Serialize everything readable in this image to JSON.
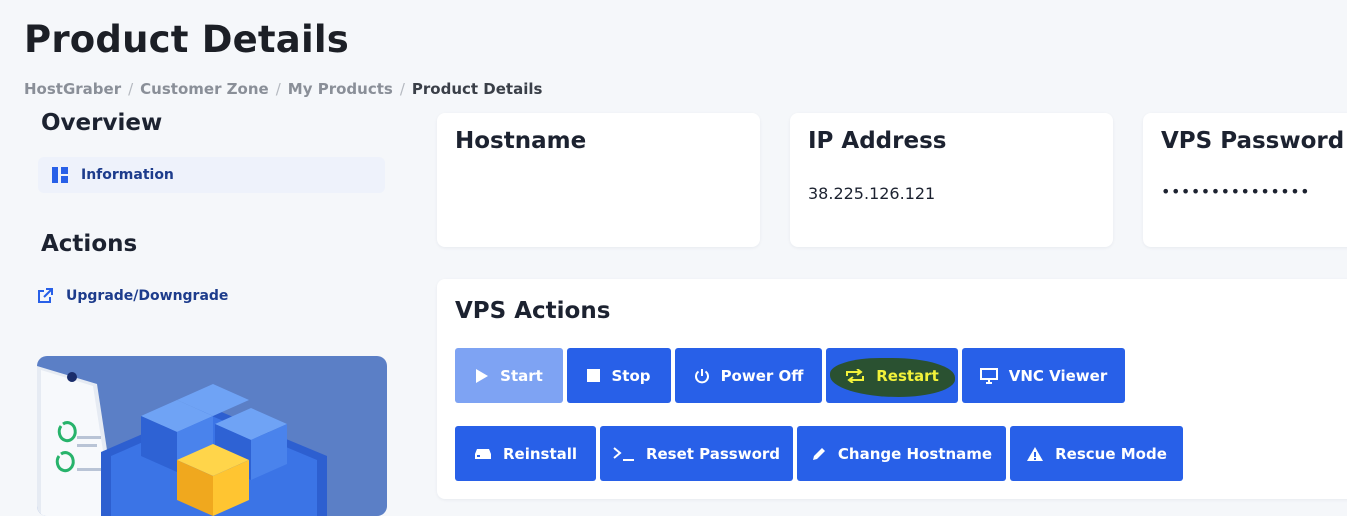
{
  "page": {
    "title": "Product Details"
  },
  "breadcrumb": [
    "HostGraber",
    "Customer Zone",
    "My Products",
    "Product Details"
  ],
  "sidebar": {
    "overview_heading": "Overview",
    "information_label": "Information",
    "actions_heading": "Actions",
    "upgrade_label": "Upgrade/Downgrade"
  },
  "cards": {
    "hostname": {
      "title": "Hostname",
      "value": ""
    },
    "ip": {
      "title": "IP Address",
      "value": "38.225.126.121"
    },
    "password": {
      "title": "VPS Password",
      "value": "•••••••••••••••"
    }
  },
  "vps_actions": {
    "heading": "VPS Actions",
    "start": "Start",
    "stop": "Stop",
    "power_off": "Power Off",
    "restart": "Restart",
    "vnc": "VNC Viewer",
    "reinstall": "Reinstall",
    "reset_password": "Reset Password",
    "change_hostname": "Change Hostname",
    "rescue_mode": "Rescue Mode"
  },
  "colors": {
    "primary": "#2860e8",
    "disabled": "#7ea3f3",
    "highlight": "#2a4f10",
    "highlight_text": "#f2f23a",
    "link": "#1d3c8c"
  },
  "icons": {
    "information": "grid-icon",
    "upgrade": "external-link-icon",
    "start": "play-icon",
    "stop": "stop-icon",
    "power_off": "power-icon",
    "restart": "repeat-icon",
    "vnc": "monitor-icon",
    "reinstall": "hard-drive-icon",
    "reset_password": "terminal-icon",
    "change_hostname": "pencil-icon",
    "rescue_mode": "warning-icon"
  }
}
